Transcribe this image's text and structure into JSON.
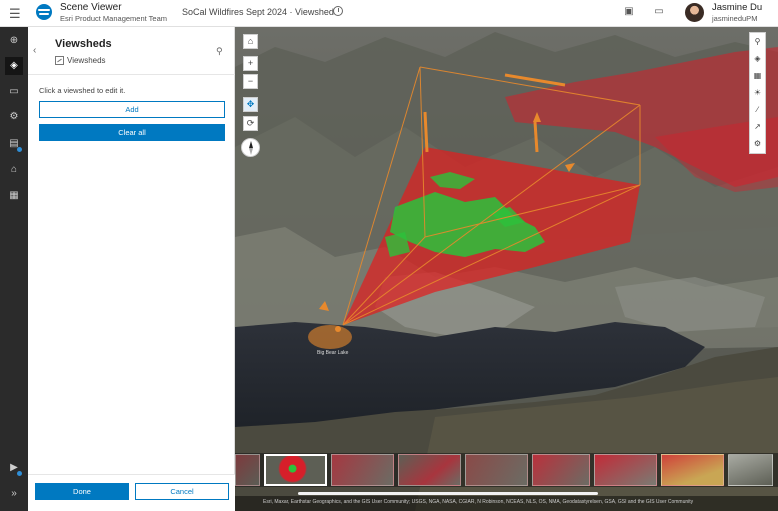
{
  "header": {
    "app_name": "Scene Viewer",
    "team": "Esri Product Management Team",
    "scene_title": "SoCal Wildfires Sept 2024 · Viewshed",
    "user_name": "Jasmine Du",
    "user_handle": "jasmineduPM"
  },
  "panel": {
    "title": "Viewsheds",
    "subtitle": "Viewsheds",
    "hint": "Click a viewshed to edit it.",
    "add_label": "Add",
    "clear_label": "Clear all",
    "done_label": "Done",
    "cancel_label": "Cancel"
  },
  "view": {
    "place_label": "Big Bear Lake",
    "attribution": "Esri, Maxar, Earthstar Geographics, and the GIS User Community; USGS, NGA, NASA, CGIAR, N Robinson, NCEAS, NLS, OS, NMA, Geodatastyrelsen, GSA, GSI and the GIS User Community",
    "thumbnail_count": 9,
    "active_thumbnail": 1
  },
  "icons": {
    "rail": [
      "add-icon",
      "layers-icon",
      "presentation-icon",
      "settings-icon",
      "legend-icon",
      "basemap-icon",
      "analysis-icon",
      "slides-icon",
      "collapse-icon"
    ],
    "map_tools": [
      "search-icon",
      "layers-icon",
      "basemap-gallery-icon",
      "daylight-icon",
      "measure-icon",
      "share-icon",
      "settings-icon"
    ]
  },
  "colors": {
    "accent": "#0079c1",
    "visible": "#2cc23b",
    "not_visible": "#e01e1e",
    "observer": "#e8892c"
  }
}
